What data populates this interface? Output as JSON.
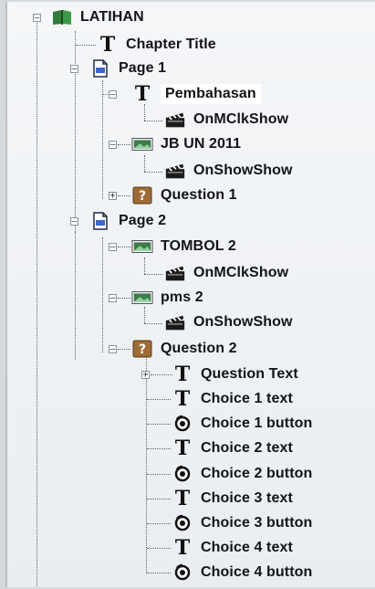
{
  "tree": {
    "root": {
      "label": "LATIHAN",
      "icon": "book-icon",
      "expanded": true
    },
    "chapter_title": {
      "label": "Chapter Title",
      "icon": "text-icon"
    },
    "page1": {
      "label": "Page 1",
      "icon": "page-icon",
      "expanded": true,
      "pembahasan": {
        "label": "Pembahasan",
        "icon": "text-icon",
        "expanded": true,
        "selected": true,
        "action": {
          "label": "OnMClkShow",
          "icon": "clapper-icon"
        }
      },
      "jb": {
        "label": "JB UN 2011",
        "icon": "image-icon",
        "expanded": true,
        "action": {
          "label": "OnShowShow",
          "icon": "clapper-icon"
        }
      },
      "question1": {
        "label": "Question 1",
        "icon": "question-icon",
        "expanded": false
      }
    },
    "page2": {
      "label": "Page 2",
      "icon": "page-icon",
      "expanded": true,
      "tombol": {
        "label": "TOMBOL 2",
        "icon": "image-icon",
        "expanded": true,
        "action": {
          "label": "OnMClkShow",
          "icon": "clapper-icon"
        }
      },
      "pms": {
        "label": "pms 2",
        "icon": "image-icon",
        "expanded": true,
        "action": {
          "label": "OnShowShow",
          "icon": "clapper-icon"
        }
      },
      "question2": {
        "label": "Question 2",
        "icon": "question-icon",
        "expanded": true,
        "question_text": {
          "label": "Question Text",
          "icon": "text-icon",
          "expanded": false
        },
        "children": [
          {
            "label": "Choice 1 text",
            "icon": "text-icon"
          },
          {
            "label": "Choice 1 button",
            "icon": "radio-icon"
          },
          {
            "label": "Choice 2 text",
            "icon": "text-icon"
          },
          {
            "label": "Choice 2 button",
            "icon": "radio-icon"
          },
          {
            "label": "Choice 3 text",
            "icon": "text-icon"
          },
          {
            "label": "Choice 3 button",
            "icon": "radio-icon"
          },
          {
            "label": "Choice 4 text",
            "icon": "text-icon"
          },
          {
            "label": "Choice 4 button",
            "icon": "radio-icon"
          }
        ]
      }
    }
  },
  "expander": {
    "expanded": "–",
    "collapsed": "+"
  },
  "colors": {
    "background": "#eef1f4",
    "text": "#121417",
    "book": "#2f7d3a",
    "image": "#3f7a4a",
    "question": "#a06a35"
  }
}
